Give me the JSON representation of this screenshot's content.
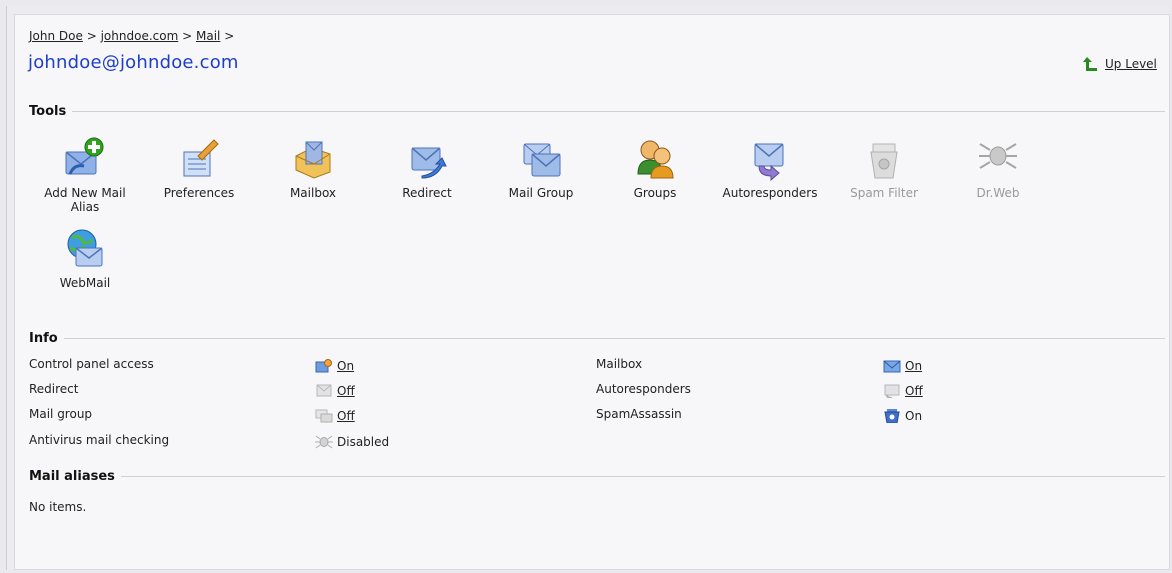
{
  "breadcrumb": {
    "items": [
      "John Doe",
      "johndoe.com",
      "Mail"
    ],
    "separator": ">"
  },
  "page_title": "johndoe@johndoe.com",
  "up_level": {
    "label": "Up Level",
    "icon": "arrow-up-icon",
    "color": "#2b8a1f"
  },
  "tools": {
    "heading": "Tools",
    "items": [
      {
        "label": "Add New Mail Alias",
        "icon": "add-mail-alias-icon",
        "enabled": true
      },
      {
        "label": "Preferences",
        "icon": "preferences-icon",
        "enabled": true
      },
      {
        "label": "Mailbox",
        "icon": "mailbox-icon",
        "enabled": true
      },
      {
        "label": "Redirect",
        "icon": "redirect-icon",
        "enabled": true
      },
      {
        "label": "Mail Group",
        "icon": "mail-group-icon",
        "enabled": true
      },
      {
        "label": "Groups",
        "icon": "groups-icon",
        "enabled": true
      },
      {
        "label": "Autoresponders",
        "icon": "autoresponders-icon",
        "enabled": true
      },
      {
        "label": "Spam Filter",
        "icon": "spam-filter-icon",
        "enabled": false
      },
      {
        "label": "Dr.Web",
        "icon": "drweb-icon",
        "enabled": false
      },
      {
        "label": "WebMail",
        "icon": "webmail-icon",
        "enabled": true
      }
    ]
  },
  "info": {
    "heading": "Info",
    "left": [
      {
        "label": "Control panel access",
        "value": "On",
        "icon": "control-panel-icon",
        "link": true
      },
      {
        "label": "Redirect",
        "value": "Off",
        "icon": "redirect-status-icon",
        "link": true
      },
      {
        "label": "Mail group",
        "value": "Off",
        "icon": "mail-group-status-icon",
        "link": true
      },
      {
        "label": "Antivirus mail checking",
        "value": "Disabled",
        "icon": "antivirus-icon",
        "link": false
      }
    ],
    "right": [
      {
        "label": "Mailbox",
        "value": "On",
        "icon": "mailbox-status-icon",
        "link": true
      },
      {
        "label": "Autoresponders",
        "value": "Off",
        "icon": "autoresponders-status-icon",
        "link": true
      },
      {
        "label": "SpamAssassin",
        "value": "On",
        "icon": "spamassassin-icon",
        "link": false
      }
    ]
  },
  "mail_aliases": {
    "heading": "Mail aliases",
    "empty_text": "No items."
  },
  "colors": {
    "title": "#1d3ec8",
    "background": "#f7f6f8",
    "divider": "#cfcfd6",
    "disabled_text": "#9a9a9a"
  }
}
